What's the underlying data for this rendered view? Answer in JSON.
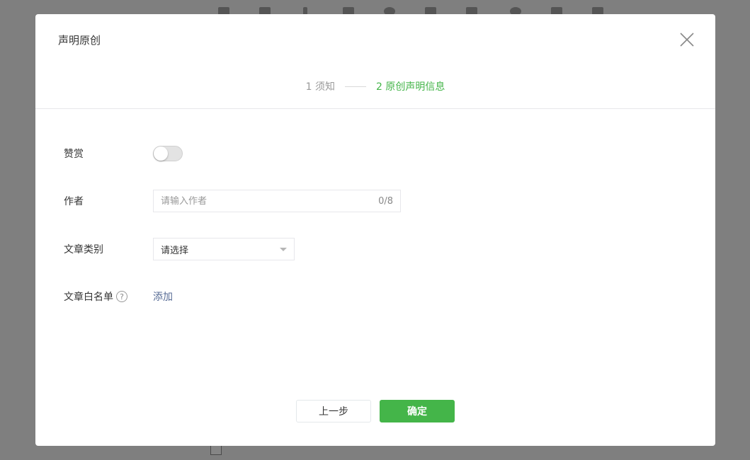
{
  "modal": {
    "title": "声明原创",
    "close_icon": "close-icon"
  },
  "steps": [
    {
      "label": "1 须知",
      "state": "done"
    },
    {
      "label": "2 原创声明信息",
      "state": "active"
    }
  ],
  "form": {
    "reward": {
      "label": "赞赏",
      "enabled": false
    },
    "author": {
      "label": "作者",
      "placeholder": "请输入作者",
      "value": "",
      "counter": "0/8"
    },
    "category": {
      "label": "文章类别",
      "selected": "请选择"
    },
    "whitelist": {
      "label": "文章白名单",
      "help_icon": "question-circle-icon",
      "help_glyph": "?",
      "action": "添加"
    }
  },
  "footer": {
    "prev_label": "上一步",
    "confirm_label": "确定"
  },
  "colors": {
    "accent": "#44b549",
    "link": "#576b95",
    "overlay": "#7f7f7f"
  }
}
